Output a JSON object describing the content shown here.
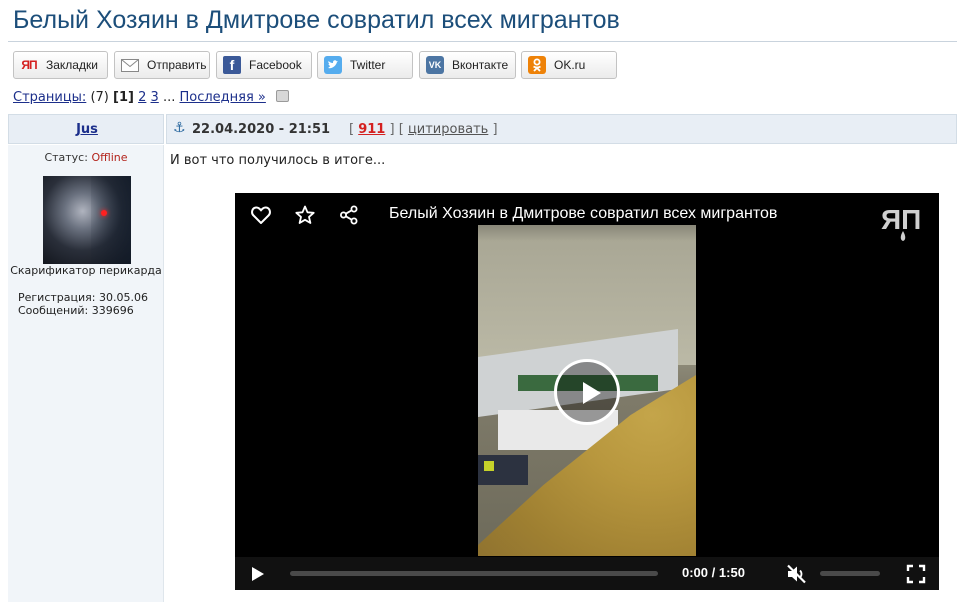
{
  "topic": {
    "title": "Белый Хозяин в Дмитрове совратил всех мигрантов"
  },
  "share": {
    "buttons": [
      {
        "label": "Закладки",
        "icon": "yap-bookmark-icon",
        "icon_text": "ЯП"
      },
      {
        "label": "Отправить",
        "icon": "envelope-icon"
      },
      {
        "label": "Facebook",
        "icon": "facebook-icon",
        "icon_text": "f"
      },
      {
        "label": "Twitter",
        "icon": "twitter-icon"
      },
      {
        "label": "Вконтакте",
        "icon": "vk-icon",
        "icon_text": "VK"
      },
      {
        "label": "OK.ru",
        "icon": "odnoklassniki-icon"
      }
    ]
  },
  "pager": {
    "label": "Страницы:",
    "count": "(7)",
    "current": "[1]",
    "pages": [
      "2",
      "3"
    ],
    "ellipsis": "...",
    "last": "Последняя »"
  },
  "post": {
    "author": "Jus",
    "date": "22.04.2020 - 21:51",
    "rep_open": "[",
    "reputation": "911",
    "rep_close": "]",
    "quote_open": "[",
    "quote": "цитировать",
    "quote_close": "]",
    "text": "И вот что получилось в итоге..."
  },
  "profile": {
    "status_label": "Статус:",
    "status_value": "Offline",
    "rank": "Скарификатор перикарда",
    "registration": "Регистрация: 30.05.06",
    "messages": "Сообщений: 339696"
  },
  "video": {
    "title": "Белый Хозяин в Дмитрове совратил всех мигрантов",
    "current_time": "0:00",
    "separator": "/",
    "duration": "1:50",
    "progress": 0,
    "muted": true,
    "logo_text": "ЯП"
  },
  "colors": {
    "title": "#1c4e7a",
    "link": "#1c2f8b",
    "reputation": "#d42020",
    "offline": "#b3231b",
    "header_bg": "#e8eef5"
  }
}
